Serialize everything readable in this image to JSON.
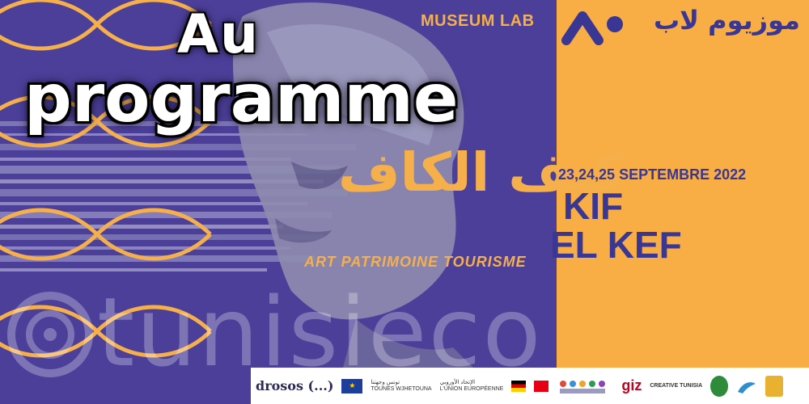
{
  "title": {
    "line1": "Au",
    "line2": "programme"
  },
  "brand": {
    "museum_lab": "MUSEUM LAB",
    "arabic_name": "موزيوم لاب"
  },
  "event": {
    "arabic_title": "كيف الكاف",
    "dates": "23,24,25 SEPTEMBRE 2022",
    "name_line1": "KIF",
    "name_line2": "EL KEF",
    "tagline": "ART  PATRIMOINE  TOURISME"
  },
  "watermark": {
    "text": "tunisieco"
  },
  "sponsors": {
    "drosos": "drosos (...)",
    "tounes_arabic": "تونس وجهتنا",
    "tounes_latin": "TOUNES WJHETOUNA",
    "eu_arabic": "الإتحاد الأوروبي",
    "eu_latin": "L'UNION EUROPÉENNE",
    "giz": "giz",
    "creative": "CREATIVE TUNISIA"
  },
  "colors": {
    "purple": "#4b3f9a",
    "orange": "#f8ad45",
    "navy": "#3a3794",
    "gold": "#f6b04b"
  }
}
